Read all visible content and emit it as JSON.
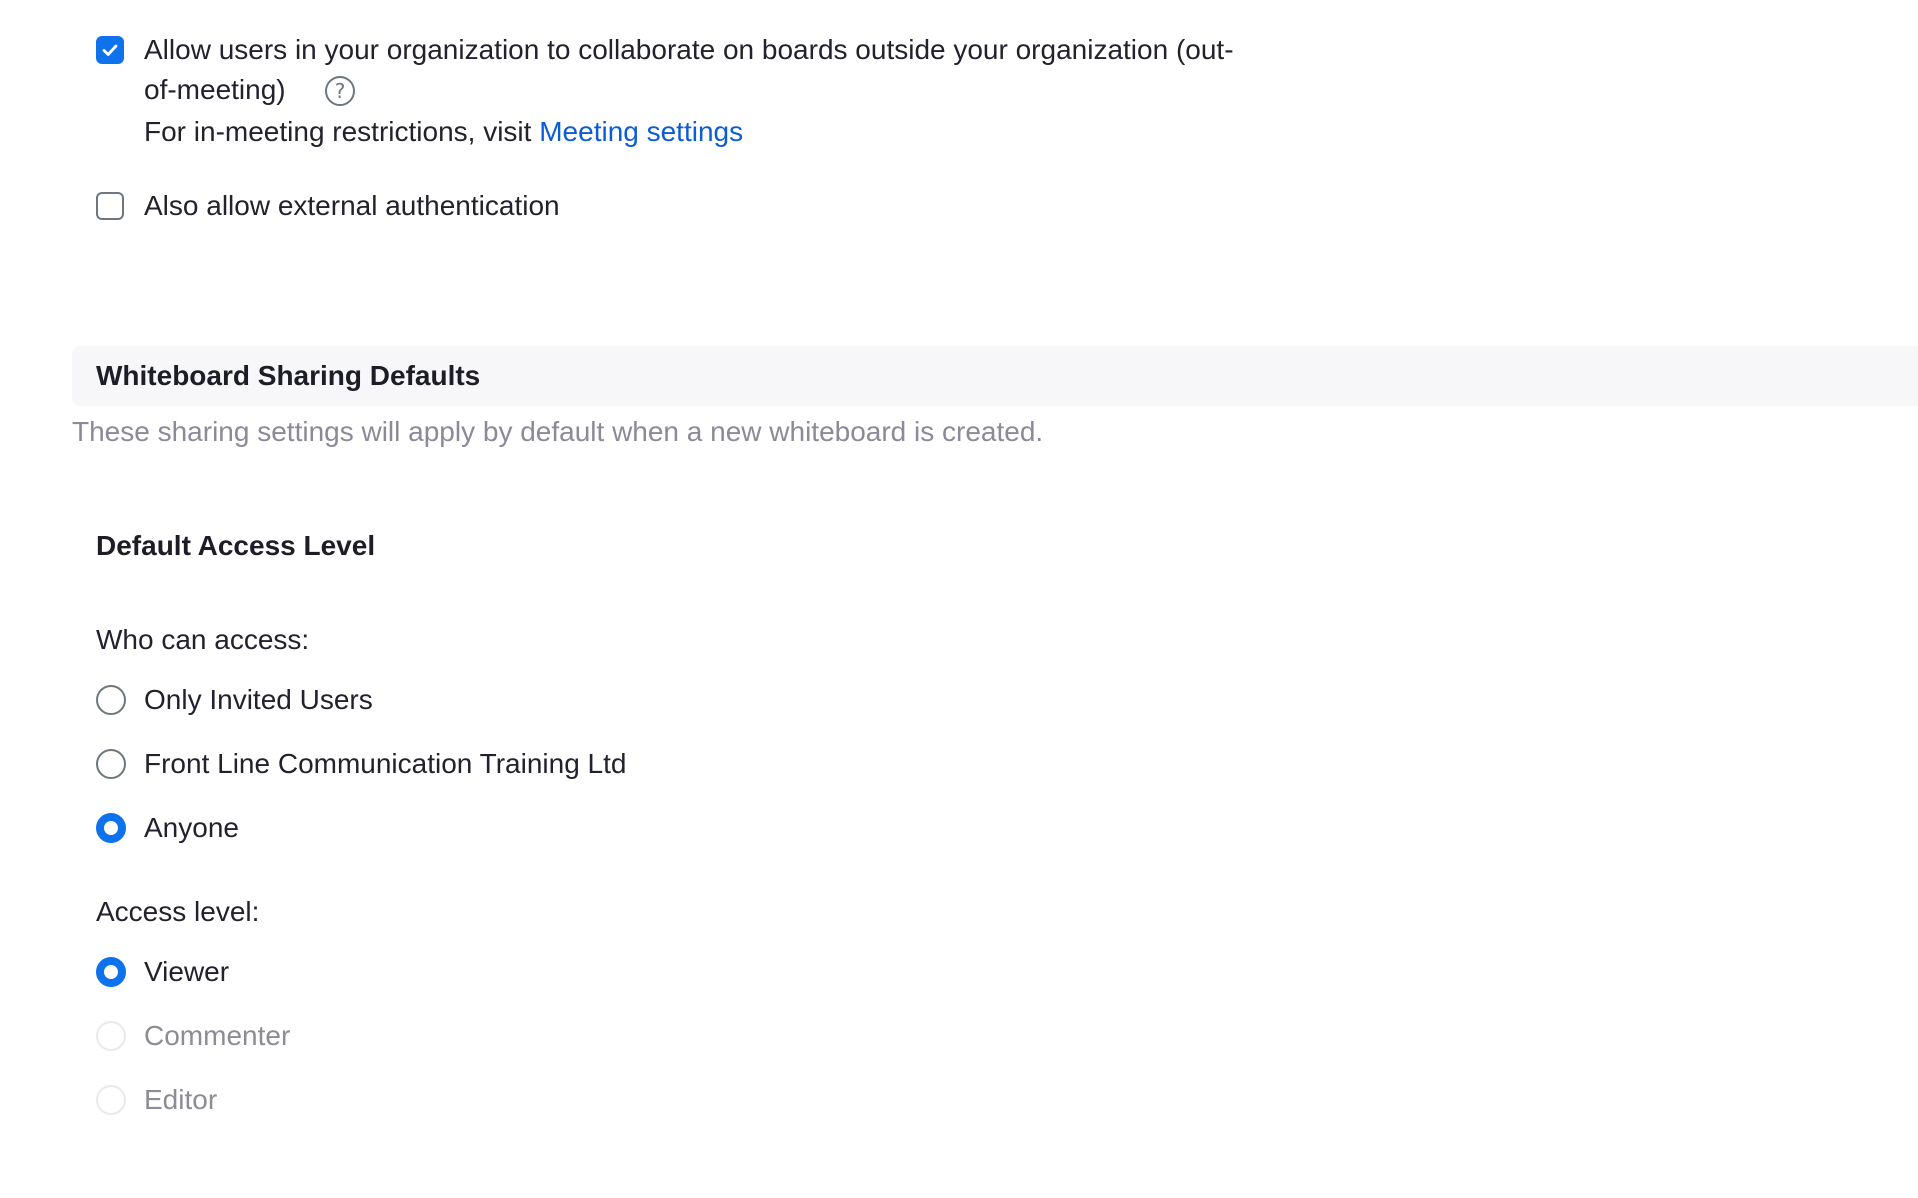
{
  "collab": {
    "checkbox_checked": true,
    "label_line1": "Allow users in your organization to collaborate on boards outside your organization (out-",
    "label_line2": "of-meeting)",
    "help_icon": "question-circle-icon",
    "help_glyph": "?",
    "note_prefix": "For in-meeting restrictions, visit ",
    "note_link": "Meeting settings"
  },
  "external_auth": {
    "checkbox_checked": false,
    "label": "Also allow external authentication"
  },
  "sharing_defaults": {
    "title": "Whiteboard Sharing Defaults",
    "description": "These sharing settings will apply by default when a new whiteboard is created."
  },
  "default_access": {
    "title": "Default Access Level",
    "who_label": "Who can access:",
    "who_options": [
      {
        "label": "Only Invited Users",
        "selected": false
      },
      {
        "label": "Front Line Communication Training Ltd",
        "selected": false
      },
      {
        "label": "Anyone",
        "selected": true
      }
    ],
    "level_label": "Access level:",
    "level_options": [
      {
        "label": "Viewer",
        "selected": true,
        "disabled": false
      },
      {
        "label": "Commenter",
        "selected": false,
        "disabled": true
      },
      {
        "label": "Editor",
        "selected": false,
        "disabled": true
      }
    ]
  },
  "colors": {
    "accent": "#0e72ed",
    "link": "#0b5cd5",
    "text": "#22222e",
    "muted": "#8a8a99",
    "section_bg": "#f7f7f9"
  }
}
